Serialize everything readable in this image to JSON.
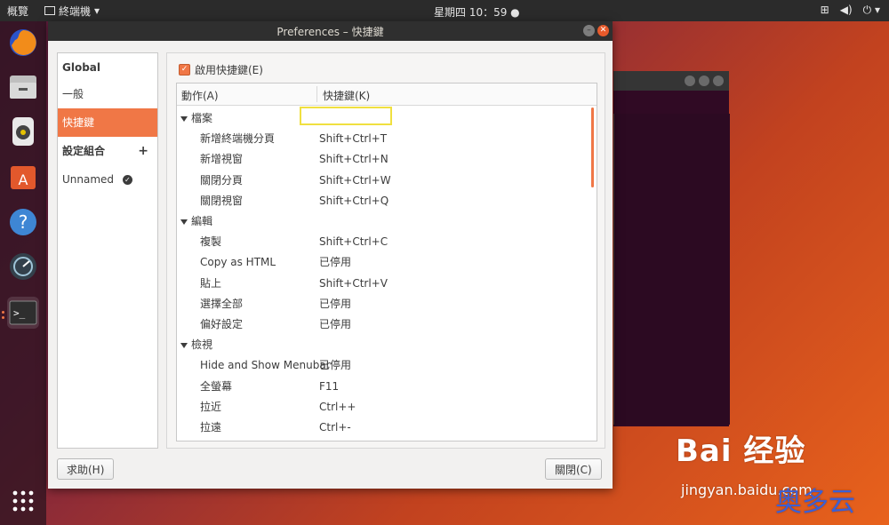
{
  "topbar": {
    "activities": "概覽",
    "app_menu": "終端機",
    "clock": "星期四 10：59",
    "tray_icons": [
      "network-icon",
      "volume-icon",
      "power-icon"
    ]
  },
  "dock": {
    "items": [
      "firefox-icon",
      "files-icon",
      "music-icon",
      "software-center-icon",
      "help-icon",
      "settings-icon",
      "terminal-icon"
    ],
    "apps_grid": "show-apps-icon"
  },
  "dialog": {
    "title": "Preferences – 快捷鍵",
    "sidebar": {
      "global_header": "Global",
      "general": "一般",
      "shortcuts": "快捷鍵",
      "profiles_header": "設定組合",
      "profile_unnamed": "Unnamed"
    },
    "enable_shortcuts_label": "啟用快捷鍵(E)",
    "columns": {
      "action": "動作(A)",
      "shortcut": "快捷鍵(K)"
    },
    "groups": [
      {
        "name": "檔案",
        "rows": [
          {
            "action": "新增終端機分頁",
            "key": "Shift+Ctrl+T"
          },
          {
            "action": "新增視窗",
            "key": "Shift+Ctrl+N"
          },
          {
            "action": "關閉分頁",
            "key": "Shift+Ctrl+W"
          },
          {
            "action": "關閉視窗",
            "key": "Shift+Ctrl+Q"
          }
        ]
      },
      {
        "name": "編輯",
        "rows": [
          {
            "action": "複製",
            "key": "Shift+Ctrl+C"
          },
          {
            "action": "Copy as HTML",
            "key": "已停用"
          },
          {
            "action": "貼上",
            "key": "Shift+Ctrl+V"
          },
          {
            "action": "選擇全部",
            "key": "已停用"
          },
          {
            "action": "偏好設定",
            "key": "已停用"
          }
        ]
      },
      {
        "name": "檢視",
        "rows": [
          {
            "action": "Hide and Show Menubar",
            "key": "已停用"
          },
          {
            "action": "全螢幕",
            "key": "F11"
          },
          {
            "action": "拉近",
            "key": "Ctrl++"
          },
          {
            "action": "拉遠",
            "key": "Ctrl+-"
          }
        ]
      }
    ],
    "help_button": "求助(H)",
    "close_button": "關閉(C)"
  },
  "watermark": {
    "brand": "Bai 经验",
    "url": "jingyan.baidu.com",
    "cn": "奥多云"
  },
  "colors": {
    "accent": "#f07746",
    "highlight_box": "#f0e040"
  }
}
